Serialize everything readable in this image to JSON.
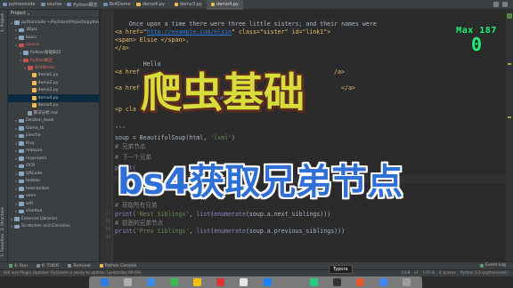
{
  "topbar": {
    "breadcrumbs": [
      "pythoncode",
      "course",
      "Python概念",
      "Bs4Demo",
      "demo4.py"
    ],
    "tabs": [
      {
        "label": "demo3.py",
        "active": false
      },
      {
        "label": "demo4.py",
        "active": true
      }
    ]
  },
  "toolstrip": {
    "labels": [
      "1: Project",
      "2: Structure",
      "3: Favorites"
    ]
  },
  "project_panel": {
    "header": "Project",
    "items": [
      {
        "label": "pythoncode  ~/PycharmProjects/pytho",
        "type": "folder",
        "indent": 0
      },
      {
        "label": "3Dpic",
        "type": "folder",
        "indent": 1
      },
      {
        "label": "basic",
        "type": "folder",
        "indent": 1
      },
      {
        "label": "course",
        "type": "folder",
        "indent": 1,
        "red": true
      },
      {
        "label": "Python基础知识",
        "type": "folder",
        "indent": 2
      },
      {
        "label": "Python概念",
        "type": "folder",
        "indent": 2,
        "red": true
      },
      {
        "label": "Bs4Demo",
        "type": "folder",
        "indent": 3,
        "red": true
      },
      {
        "label": "demo1.py",
        "type": "file",
        "indent": 4
      },
      {
        "label": "demo2.py",
        "type": "file",
        "indent": 4
      },
      {
        "label": "demo3.py",
        "type": "file",
        "indent": 4
      },
      {
        "label": "demo4.py",
        "type": "file",
        "indent": 4,
        "selected": true
      },
      {
        "label": "demo5.py",
        "type": "file",
        "indent": 4
      },
      {
        "label": "算法分析.md",
        "type": "md",
        "indent": 3
      },
      {
        "label": "Douban_book",
        "type": "folder",
        "indent": 1
      },
      {
        "label": "Game_tk",
        "type": "folder",
        "indent": 1
      },
      {
        "label": "jiancho",
        "type": "folder",
        "indent": 1
      },
      {
        "label": "Kivy",
        "type": "folder",
        "indent": 1
      },
      {
        "label": "maoyan",
        "type": "folder",
        "indent": 1
      },
      {
        "label": "myproject",
        "type": "folder",
        "indent": 1
      },
      {
        "label": "OCR",
        "type": "folder",
        "indent": 1
      },
      {
        "label": "QRCode",
        "type": "folder",
        "indent": 1
      },
      {
        "label": "taobao",
        "type": "folder",
        "indent": 1
      },
      {
        "label": "textcombie",
        "type": "folder",
        "indent": 1
      },
      {
        "label": "venv",
        "type": "folder",
        "indent": 1
      },
      {
        "label": "wifi",
        "type": "folder",
        "indent": 1
      },
      {
        "label": "xiaohua",
        "type": "folder",
        "indent": 1
      },
      {
        "label": "External Libraries",
        "type": "folder",
        "indent": 0
      },
      {
        "label": "Scratches and Consoles",
        "type": "folder",
        "indent": 0
      }
    ]
  },
  "editor": {
    "line_numbers": [
      "",
      "",
      "",
      "",
      "",
      "",
      "",
      "",
      "",
      "",
      "",
      "",
      "",
      "",
      "",
      "",
      "",
      "",
      "",
      "",
      "",
      "",
      "",
      "",
      "",
      "27",
      "28",
      "29",
      "30"
    ],
    "lines": {
      "l1": "    Once upon a time there were three little sisters; and their names were",
      "l2_pre": "<a href=\"",
      "l2_url": "http://example.com/elsie",
      "l2_post": "\" class=\"sister\" id=\"link1\">",
      "l3": "<span> Elsie </span>,",
      "l4": "</a>",
      "l5": "        Hello",
      "l6": "<a href",
      "l6_end": "/a>",
      "l7": "<a href",
      "l7_end": "</a>",
      "l8": "                         at the b",
      "l9": "<p cla",
      "l10": "\"\"\"",
      "l11_pre": "soup = ",
      "l11_fn": "BeautifulSoup",
      "l11_mid": "(html, ",
      "l11_str": "'lxml'",
      "l11_post": ")",
      "l12": "# 兄弟节点",
      "l13": "# 下一个兄弟",
      "l14": "print(",
      "l14_end": "ib",
      "l15": "                      us_s",
      "l16": "# 获取所有兄弟",
      "l17_a": "print(",
      "l17_s": "'Next Siblings'",
      "l17_b": ", ",
      "l17_c": "list",
      "l17_d": "(",
      "l17_e": "enumerate",
      "l17_f": "(soup.a.next_siblings)))",
      "l18": "# 前面的兄弟节点",
      "l19_a": "print(",
      "l19_s": "'Prev Siblings'",
      "l19_b": ", ",
      "l19_c": "list",
      "l19_d": "(",
      "l19_e": "enumerate",
      "l19_f": "(soup.a.previous_siblings)))"
    }
  },
  "overlay": {
    "title": "爬虫基础",
    "subtitle": "bs4获取兄弟节点"
  },
  "max_counter": {
    "label": "Max 187",
    "value": "0"
  },
  "bottom_tools": [
    "4: Run",
    "6: TODO",
    "Terminal",
    "Python Console"
  ],
  "event_log": "Event Log",
  "status": {
    "message": "IDE and Plugin Updates: PyCharm is ready to update. (yesterday 08:09)",
    "position": "24:8",
    "line_sep": "LF",
    "encoding": "UTF-8",
    "indent": "4 spaces",
    "interpreter": "Python 3.6 (pythoncode)"
  },
  "tooltip": "Typora",
  "colors": {
    "title_yellow": "#d9dd3b",
    "subtitle_blue": "#2f6fd6",
    "counter_green": "#2ee87e"
  }
}
